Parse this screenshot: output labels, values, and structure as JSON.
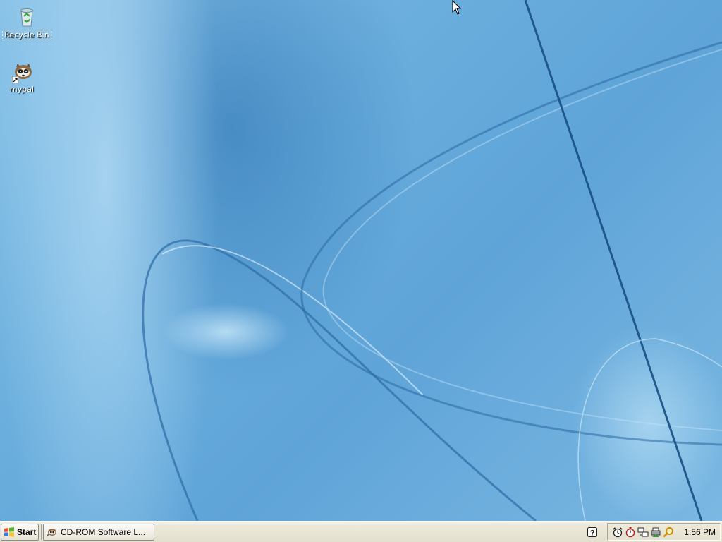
{
  "desktop": {
    "icons": [
      {
        "label": "Recycle Bin",
        "icon": "recycle-bin-icon",
        "selected": true
      },
      {
        "label": "mypal",
        "icon": "mypal-browser-icon",
        "shortcut": true
      }
    ]
  },
  "taskbar": {
    "start_label": "Start",
    "tasks": [
      {
        "label": "CD-ROM Software L...",
        "icon": "cdrom-software-icon"
      }
    ],
    "quick_icon": "help-icon",
    "tray_icons": [
      "alarm-clock-icon",
      "stopwatch-icon",
      "network-icon",
      "printer-icon",
      "search-icon"
    ],
    "clock": "1:56 PM"
  },
  "colors": {
    "wallpaper_base": "#6aaedd",
    "taskbar": "#ece9d8"
  }
}
